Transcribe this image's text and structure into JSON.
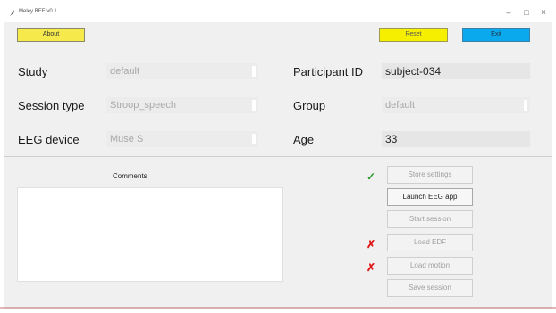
{
  "window": {
    "title": "Meley BEE v0.1",
    "controls": {
      "minimize": "–",
      "maximize": "□",
      "close": "×"
    }
  },
  "toolbar": {
    "about_label": "About",
    "reset_label": "Reset",
    "exit_label": "Exit"
  },
  "form": {
    "study_label": "Study",
    "study_value": "default",
    "session_type_label": "Session type",
    "session_type_value": "Stroop_speech",
    "eeg_device_label": "EEG device",
    "eeg_device_value": "Muse S",
    "participant_id_label": "Participant ID",
    "participant_id_value": "subject-034",
    "group_label": "Group",
    "group_value": "default",
    "age_label": "Age",
    "age_value": "33"
  },
  "comments": {
    "label": "Comments",
    "value": ""
  },
  "actions": {
    "store_settings": "Store settings",
    "launch_eeg_app": "Launch EEG app",
    "start_session": "Start session",
    "load_edf": "Load EDF",
    "load_motion": "Load motion",
    "save_session": "Save session"
  },
  "status": {
    "store_settings_mark": "✓",
    "load_edf_mark": "✗",
    "load_motion_mark": "✗"
  },
  "colors": {
    "about": "#f5e94c",
    "reset": "#f6f000",
    "exit": "#0aa9ee",
    "ok": "#2c9a2c",
    "error": "#e01818"
  }
}
